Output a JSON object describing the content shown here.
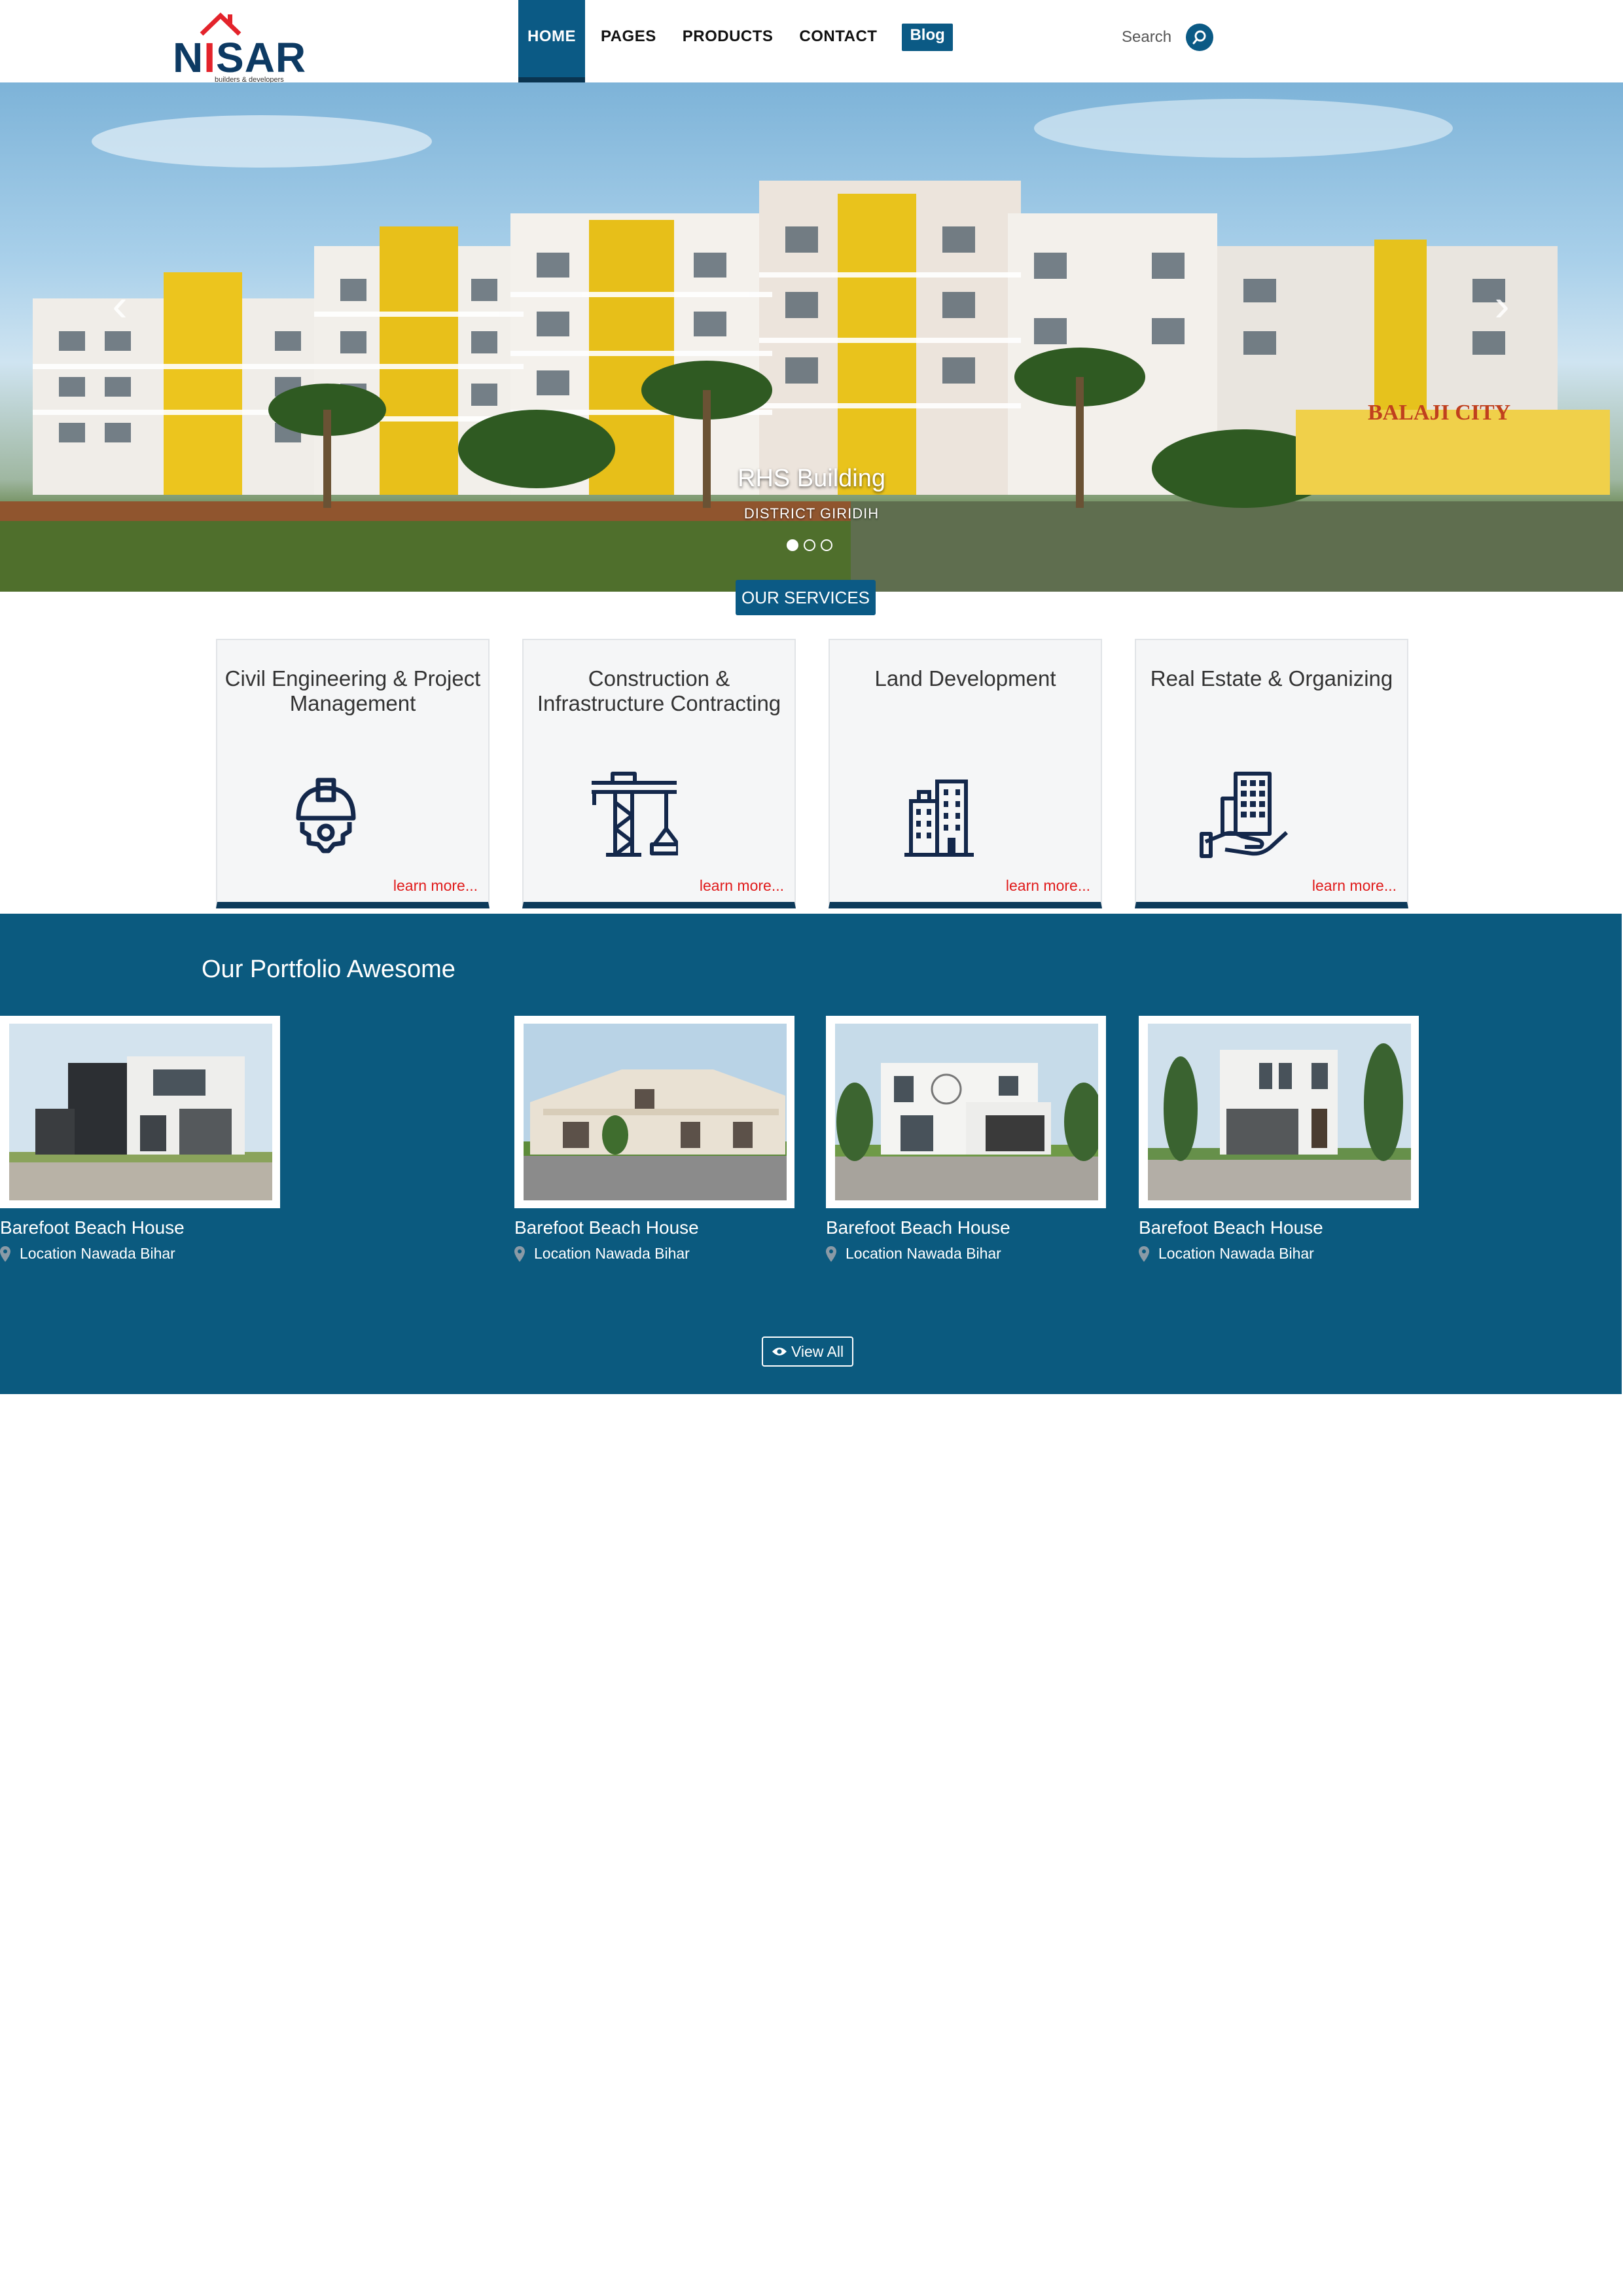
{
  "brand": {
    "logo_text_pre": "N",
    "logo_text_i": "I",
    "logo_text_post": "SAR",
    "tagline": "builders & developers"
  },
  "nav": {
    "items": [
      "HOME",
      "PAGES",
      "PRODUCTS",
      "CONTACT"
    ],
    "blog_label": "Blog",
    "active_index": 0
  },
  "search": {
    "label": "Search",
    "icon": "search-icon"
  },
  "hero": {
    "caption_title": "RHS Building",
    "caption_subtitle": "DISTRICT GIRIDIH",
    "sign_text": "BALAJI CITY",
    "slides": 3,
    "active_slide": 0
  },
  "services": {
    "badge": "OUR SERVICES",
    "items": [
      {
        "title": "Civil Engineering & Project Management",
        "icon": "helmet-gear-icon",
        "link": "learn more..."
      },
      {
        "title": "Construction & Infrastructure Contracting",
        "icon": "crane-icon",
        "link": "learn more..."
      },
      {
        "title": "Land Development",
        "icon": "buildings-icon",
        "link": "learn more..."
      },
      {
        "title": "Real Estate & Organizing",
        "icon": "hand-building-icon",
        "link": "learn more..."
      }
    ]
  },
  "portfolio": {
    "heading": "Our Portfolio Awesome",
    "items": [
      {
        "name": "Barefoot Beach House",
        "location": "Location Nawada Bihar"
      },
      {
        "name": "Barefoot Beach House",
        "location": "Location Nawada Bihar"
      },
      {
        "name": "Barefoot Beach House",
        "location": "Location Nawada Bihar"
      },
      {
        "name": "Barefoot Beach House",
        "location": "Location Nawada Bihar"
      }
    ],
    "view_all": "View All"
  },
  "colors": {
    "primary": "#0b5a85",
    "dark_navy": "#0d3a5a",
    "portfolio_bg": "#0b5a7f",
    "link_red": "#e01b1b",
    "logo_red": "#e3232b"
  }
}
